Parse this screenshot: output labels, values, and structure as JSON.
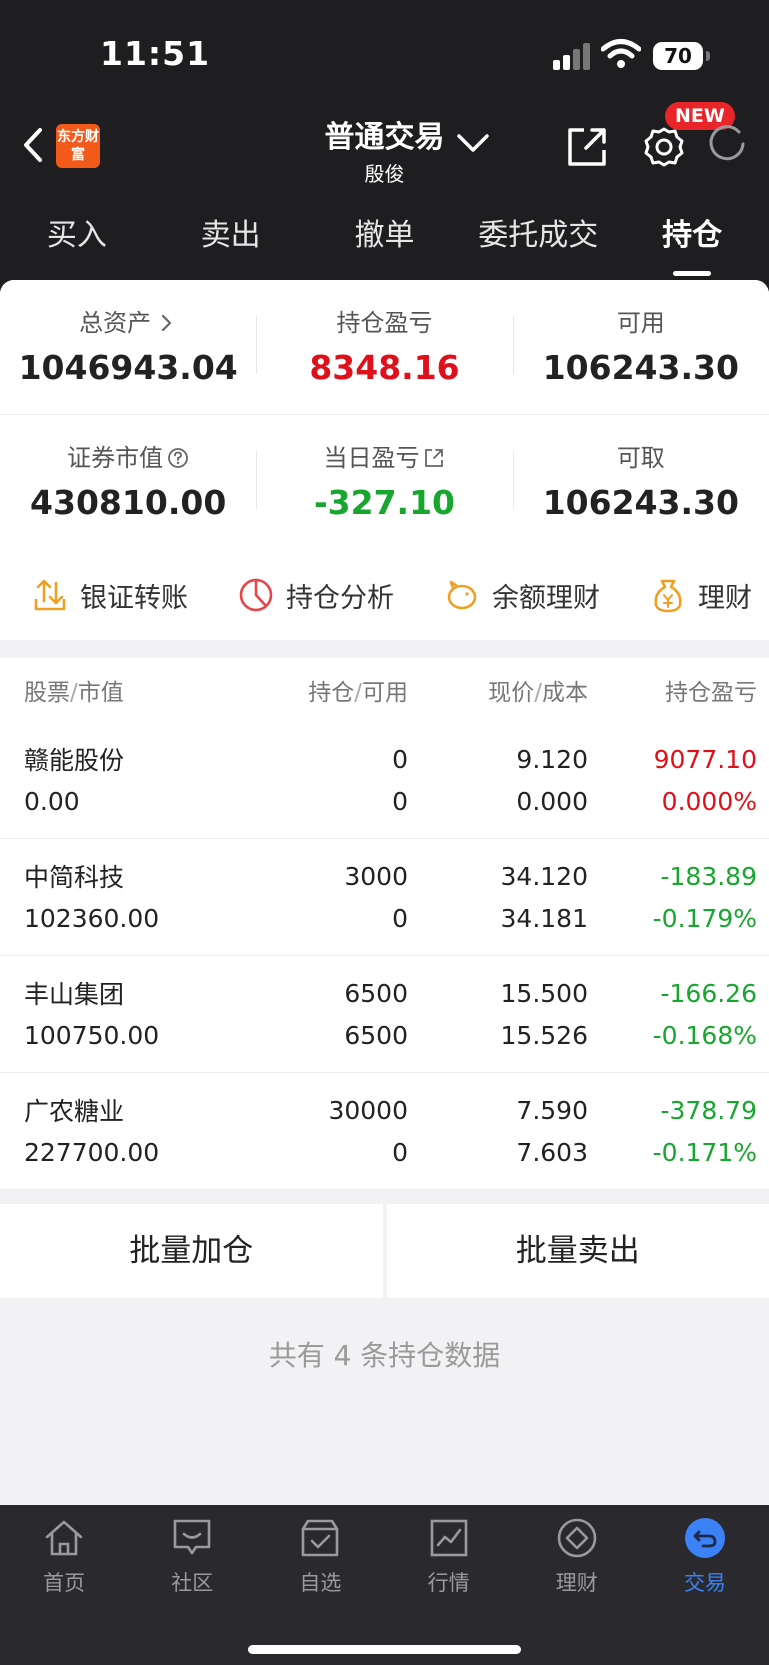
{
  "status_bar": {
    "time": "11:51",
    "battery": "70"
  },
  "header": {
    "logo_text": "东方财富",
    "title": "普通交易",
    "subtitle": "殷俊",
    "new_badge": "NEW"
  },
  "tabs": [
    {
      "label": "买入"
    },
    {
      "label": "卖出"
    },
    {
      "label": "撤单"
    },
    {
      "label": "委托成交"
    },
    {
      "label": "持仓"
    }
  ],
  "summary": {
    "total_assets_label": "总资产",
    "total_assets": "1046943.04",
    "position_pl_label": "持仓盈亏",
    "position_pl": "8348.16",
    "available_label": "可用",
    "available": "106243.30",
    "market_value_label": "证券市值",
    "market_value": "430810.00",
    "daily_pl_label": "当日盈亏",
    "daily_pl": "-327.10",
    "withdrawable_label": "可取",
    "withdrawable": "106243.30"
  },
  "shortcuts": [
    {
      "label": "银证转账",
      "icon": "transfer-icon"
    },
    {
      "label": "持仓分析",
      "icon": "pie-chart-icon"
    },
    {
      "label": "余额理财",
      "icon": "piggy-bank-icon"
    },
    {
      "label": "理财",
      "icon": "money-bag-icon"
    }
  ],
  "table": {
    "headers": {
      "stock": "股票",
      "market_value": "市值",
      "holding": "持仓",
      "available": "可用",
      "price": "现价",
      "cost": "成本",
      "pl": "持仓盈亏"
    },
    "rows": [
      {
        "name": "赣能股份",
        "value": "0.00",
        "holding": "0",
        "available": "0",
        "price": "9.120",
        "cost": "0.000",
        "pl": "9077.10",
        "pl_pct": "0.000%",
        "trend": "up"
      },
      {
        "name": "中简科技",
        "value": "102360.00",
        "holding": "3000",
        "available": "0",
        "price": "34.120",
        "cost": "34.181",
        "pl": "-183.89",
        "pl_pct": "-0.179%",
        "trend": "down"
      },
      {
        "name": "丰山集团",
        "value": "100750.00",
        "holding": "6500",
        "available": "6500",
        "price": "15.500",
        "cost": "15.526",
        "pl": "-166.26",
        "pl_pct": "-0.168%",
        "trend": "down"
      },
      {
        "name": "广农糖业",
        "value": "227700.00",
        "holding": "30000",
        "available": "0",
        "price": "7.590",
        "cost": "7.603",
        "pl": "-378.79",
        "pl_pct": "-0.171%",
        "trend": "down"
      }
    ]
  },
  "batch": {
    "add_label": "批量加仓",
    "sell_label": "批量卖出"
  },
  "footer_note": "共有 4 条持仓数据",
  "bottom_nav": [
    {
      "label": "首页",
      "icon": "home-icon"
    },
    {
      "label": "社区",
      "icon": "community-icon"
    },
    {
      "label": "自选",
      "icon": "watchlist-icon"
    },
    {
      "label": "行情",
      "icon": "market-icon"
    },
    {
      "label": "理财",
      "icon": "wealth-icon"
    },
    {
      "label": "交易",
      "icon": "trade-icon"
    }
  ],
  "colors": {
    "up": "#e0101a",
    "down": "#17a62e",
    "accent": "#3b82f6",
    "brand": "#f25a1c"
  }
}
